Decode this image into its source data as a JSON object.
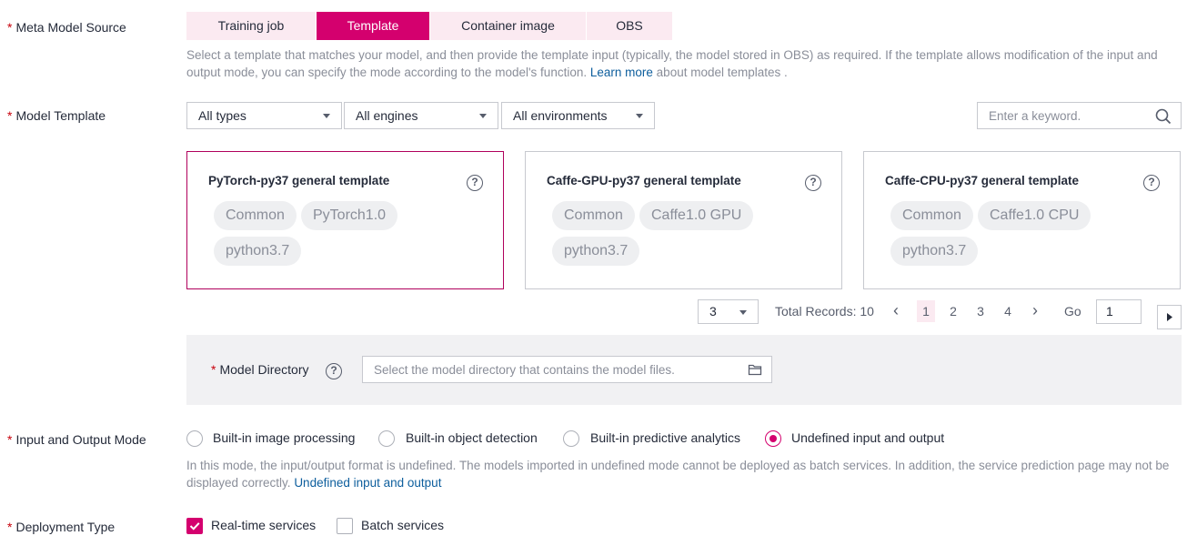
{
  "meta_model_source": {
    "label": "Meta Model Source",
    "tabs": [
      {
        "label": "Training job",
        "active": false
      },
      {
        "label": "Template",
        "active": true
      },
      {
        "label": "Container image",
        "active": false
      },
      {
        "label": "OBS",
        "active": false
      }
    ],
    "hint": "Select a template that matches your model, and then provide the template input (typically, the model stored in OBS) as required. If the template allows modification of the input and output mode, you can specify the mode according to the model's function.",
    "hint_link": "Learn more",
    "hint_suffix": "about model templates ."
  },
  "model_template": {
    "label": "Model Template",
    "filters": {
      "types": "All types",
      "engines": "All engines",
      "environments": "All environments"
    },
    "search_placeholder": "Enter a keyword.",
    "cards": [
      {
        "title": "PyTorch-py37 general template",
        "tags": [
          "Common",
          "PyTorch1.0",
          "python3.7"
        ],
        "selected": true
      },
      {
        "title": "Caffe-GPU-py37 general template",
        "tags": [
          "Common",
          "Caffe1.0 GPU",
          "python3.7"
        ],
        "selected": false
      },
      {
        "title": "Caffe-CPU-py37 general template",
        "tags": [
          "Common",
          "Caffe1.0 CPU",
          "python3.7"
        ],
        "selected": false
      }
    ],
    "pagination": {
      "page_size": "3",
      "total": "Total Records: 10",
      "pages": [
        "1",
        "2",
        "3",
        "4"
      ],
      "current_page": "1",
      "go_label": "Go",
      "go_value": "1",
      "prev": "‹",
      "next": "›"
    }
  },
  "model_directory": {
    "label": "Model Directory",
    "placeholder": "Select the model directory that contains the model files."
  },
  "io_mode": {
    "label": "Input and Output Mode",
    "options": [
      {
        "label": "Built-in image processing",
        "selected": false
      },
      {
        "label": "Built-in object detection",
        "selected": false
      },
      {
        "label": "Built-in predictive analytics",
        "selected": false
      },
      {
        "label": "Undefined input and output",
        "selected": true
      }
    ],
    "hint": "In this mode, the input/output format is undefined. The models imported in undefined mode cannot be deployed as batch services. In addition, the service prediction page may not be displayed correctly.",
    "hint_link": "Undefined input and output"
  },
  "deployment_type": {
    "label": "Deployment Type",
    "options": [
      {
        "label": "Real-time services",
        "checked": true
      },
      {
        "label": "Batch services",
        "checked": false
      }
    ]
  },
  "colors": {
    "accent": "#d4006e",
    "accent_light": "#fbeaf1",
    "required": "#c7000b",
    "link": "#0d5e9d"
  }
}
